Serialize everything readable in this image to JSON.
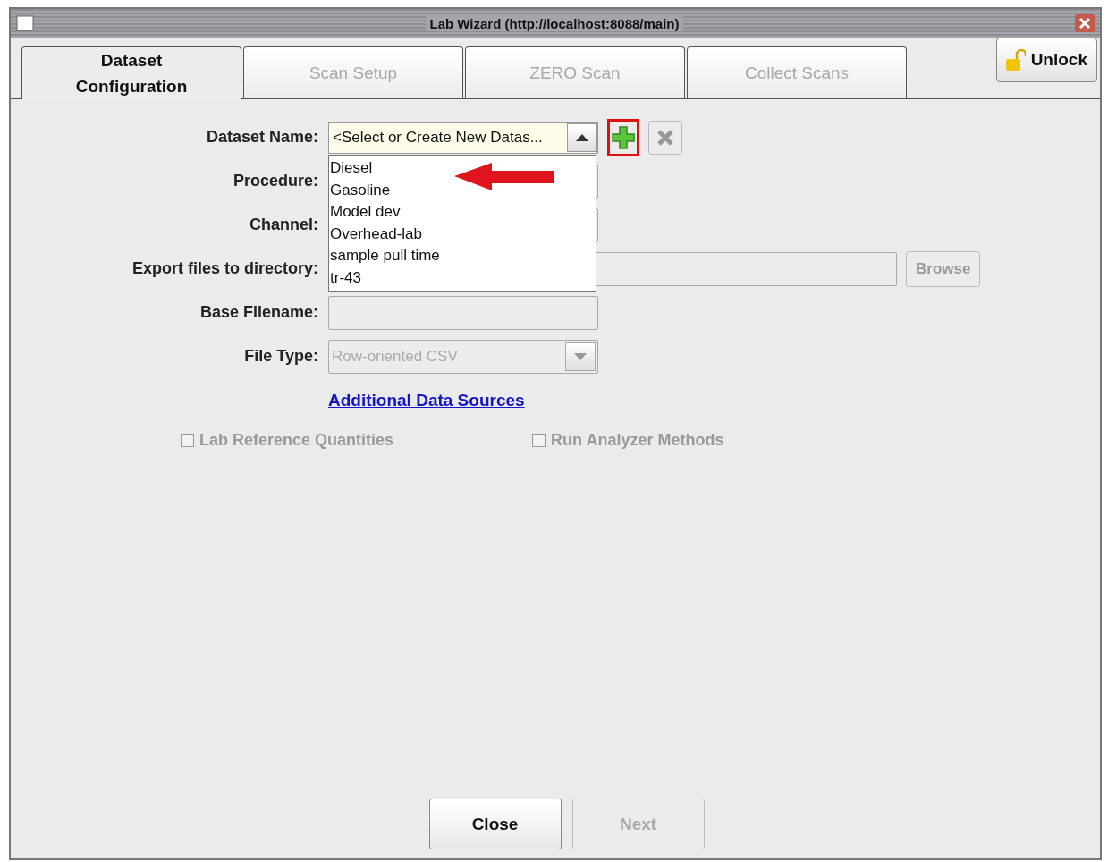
{
  "window": {
    "title": "Lab Wizard (http://localhost:8088/main)"
  },
  "tabs": [
    {
      "label": "Dataset Configuration",
      "selected": true
    },
    {
      "label": "Scan Setup",
      "selected": false
    },
    {
      "label": "ZERO Scan",
      "selected": false
    },
    {
      "label": "Collect Scans",
      "selected": false
    }
  ],
  "unlock_button": {
    "label": "Unlock"
  },
  "form": {
    "dataset_name": {
      "label": "Dataset Name:",
      "value": "<Select or Create New Datas...",
      "expanded": true,
      "options": [
        "Diesel",
        "Gasoline",
        "Model dev",
        "Overhead-lab",
        "sample pull time",
        "tr-43"
      ]
    },
    "procedure": {
      "label": "Procedure:"
    },
    "channel": {
      "label": "Channel:"
    },
    "export_directory": {
      "label": "Export files to directory:",
      "browse_button": {
        "label": "Browse",
        "disabled": true
      }
    },
    "base_filename": {
      "label": "Base Filename:"
    },
    "file_type": {
      "label": "File Type:",
      "value": "Row-oriented CSV",
      "disabled": true
    }
  },
  "additional_sources_link": "Additional Data Sources",
  "checkboxes": [
    {
      "label": "Lab Reference Quantities",
      "checked": false,
      "disabled": true
    },
    {
      "label": "Run Analyzer Methods",
      "checked": false,
      "disabled": true
    }
  ],
  "buttons": [
    {
      "label": "Close",
      "disabled": false
    },
    {
      "label": "Next",
      "disabled": true
    }
  ]
}
